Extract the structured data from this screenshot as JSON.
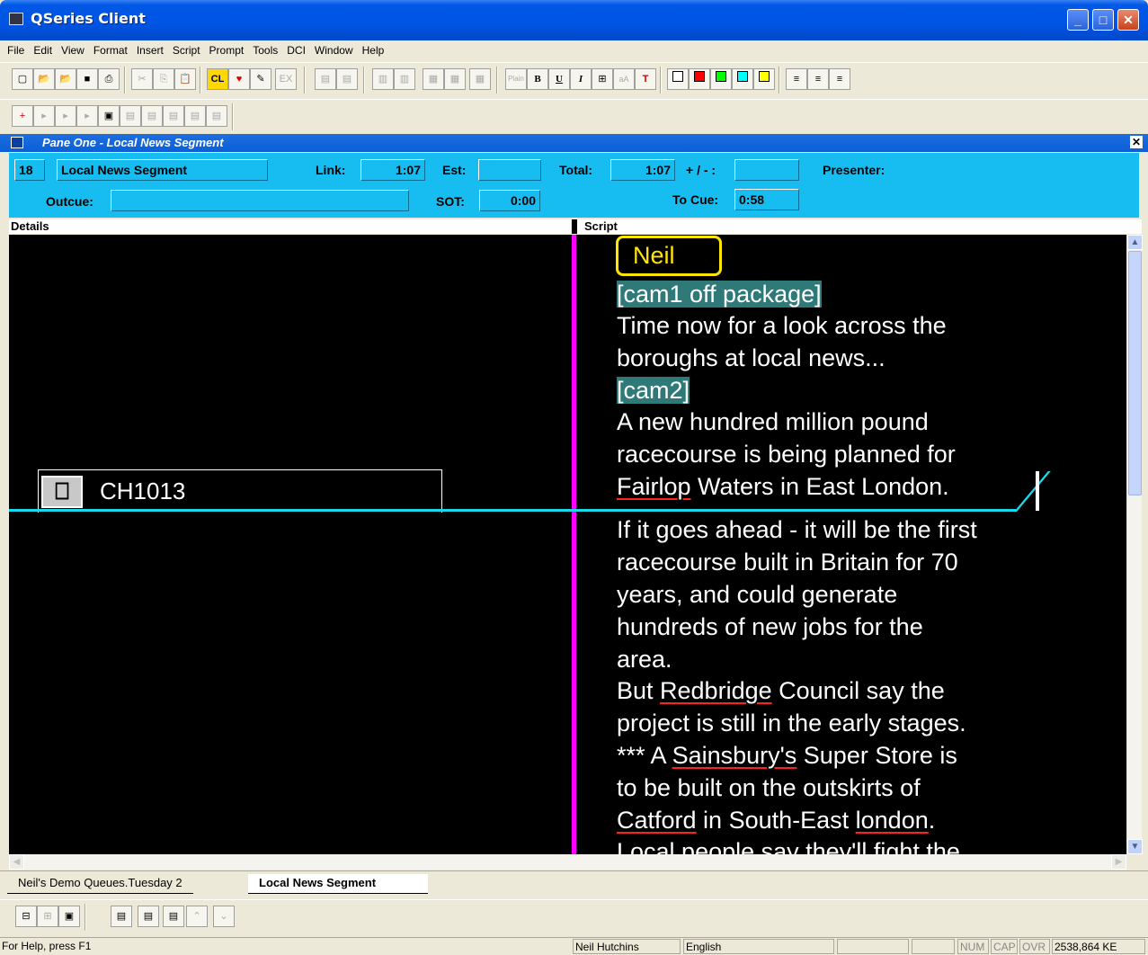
{
  "window": {
    "title": "QSeries Client"
  },
  "menu": [
    "File",
    "Edit",
    "View",
    "Format",
    "Insert",
    "Script",
    "Prompt",
    "Tools",
    "DCI",
    "Window",
    "Help"
  ],
  "toolbar": {
    "plain_label": "Plain",
    "bold_label": "B",
    "underline_label": "U",
    "italic_label": "I",
    "cl_label": "CL",
    "ex_label": "EX"
  },
  "pane": {
    "title": "Pane One - Local News Segment"
  },
  "info": {
    "number": "18",
    "segment": "Local News Segment",
    "link_label": "Link:",
    "link_value": "1:07",
    "est_label": "Est:",
    "est_value": "",
    "total_label": "Total:",
    "total_value": "1:07",
    "plusminus_label": "+ / - :",
    "plusminus_value": "",
    "presenter_label": "Presenter:",
    "outcue_label": "Outcue:",
    "outcue_value": "",
    "sot_label": "SOT:",
    "sot_value": "0:00",
    "tocue_label": "To Cue:",
    "tocue_value": "0:58"
  },
  "columns": {
    "details": "Details",
    "script": "Script"
  },
  "details": {
    "clip_id": "CH1013"
  },
  "script": {
    "presenter": "Neil",
    "cam1": "[cam1 off package]",
    "l1": "Time now for a look across the",
    "l2": "boroughs at local news...",
    "cam2": "[cam2]",
    "l3": "A new hundred million pound",
    "l4": "racecourse is being planned for",
    "l5a": "Fairlop",
    "l5b": " Waters in East London.",
    "l6": "If it goes ahead - it will be the first",
    "l7": "racecourse built in Britain for 70",
    "l8": "years, and could generate",
    "l9": "hundreds of new jobs for the",
    "l10": "area.",
    "l11a": "But ",
    "l11b": "Redbridge",
    "l11c": " Council say the",
    "l12": "project is still in the early stages.",
    "l13a": "***  A ",
    "l13b": "Sainsbury's",
    "l13c": " Super Store is",
    "l14": "to be built on the outskirts of",
    "l15a": "Catford",
    "l15b": " in South-East ",
    "l15c": "london",
    "l15d": ".",
    "l16": "Local people say they'll fight the"
  },
  "tabs": {
    "tab1": "Neil's Demo Queues.Tuesday 2",
    "tab2": "Local News Segment"
  },
  "status": {
    "help": "For Help, press F1",
    "user": "Neil Hutchins",
    "language": "English",
    "num": "NUM",
    "cap": "CAP",
    "ovr": "OVR",
    "size": "2538,864 KE"
  },
  "colors": {
    "accent": "#17bdf0",
    "presenter": "#ffe600",
    "cue": "#19d8e8",
    "marker": "#ff00ff"
  }
}
